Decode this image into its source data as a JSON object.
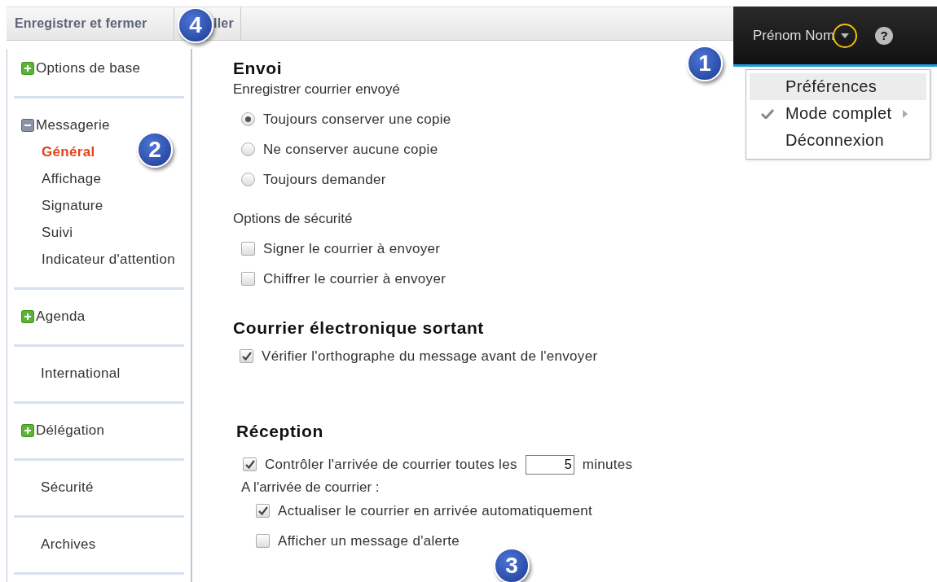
{
  "toolbar": {
    "buttons": [
      "Enregistrer et fermer",
      "ller"
    ]
  },
  "header": {
    "user_name": "Prénom Nom",
    "help": "?"
  },
  "user_menu": {
    "items": [
      {
        "label": "Préférences",
        "selected": true,
        "checked": false,
        "submenu": false
      },
      {
        "label": "Mode complet",
        "selected": false,
        "checked": true,
        "submenu": true
      },
      {
        "label": "Déconnexion",
        "selected": false,
        "checked": false,
        "submenu": false
      }
    ]
  },
  "sidebar": {
    "groups": [
      {
        "label": "Options de base",
        "kind": "collapsed",
        "selected": false
      },
      {
        "label": "Messagerie",
        "kind": "expanded",
        "selected": false,
        "children": [
          {
            "label": "Général",
            "selected": true
          },
          {
            "label": "Affichage",
            "selected": false
          },
          {
            "label": "Signature",
            "selected": false
          },
          {
            "label": "Suivi",
            "selected": false
          },
          {
            "label": "Indicateur d'attention",
            "selected": false
          }
        ]
      },
      {
        "label": "Agenda",
        "kind": "collapsed",
        "selected": false
      },
      {
        "label": "International",
        "kind": "leaf",
        "selected": false
      },
      {
        "label": "Délégation",
        "kind": "collapsed",
        "selected": false
      },
      {
        "label": "Sécurité",
        "kind": "leaf",
        "selected": false
      },
      {
        "label": "Archives",
        "kind": "leaf",
        "selected": false
      }
    ]
  },
  "sections": [
    {
      "title": "Envoi",
      "items": [
        {
          "kind": "label",
          "label": "Enregistrer courrier envoyé",
          "children": [
            {
              "kind": "radio",
              "label": "Toujours conserver une copie",
              "checked": true
            },
            {
              "kind": "radio",
              "label": "Ne conserver aucune copie",
              "checked": false
            },
            {
              "kind": "radio",
              "label": "Toujours demander",
              "checked": false
            }
          ]
        },
        {
          "kind": "label",
          "label": "Options de sécurité",
          "children": [
            {
              "kind": "checkbox",
              "label": "Signer le courrier à envoyer",
              "checked": false
            },
            {
              "kind": "checkbox",
              "label": "Chiffrer le courrier à envoyer",
              "checked": false
            }
          ]
        }
      ]
    },
    {
      "title": "Courrier électronique sortant",
      "items": [
        {
          "kind": "checkbox",
          "label": "Vérifier l'orthographe du message avant de l'envoyer",
          "checked": true
        }
      ]
    },
    {
      "title": "Réception",
      "items": [
        {
          "kind": "checkbox-input",
          "label": "Contrôler l'arrivée de courrier toutes les",
          "value": "5",
          "suffix": "minutes",
          "checked": true
        },
        {
          "kind": "label",
          "label": "A l'arrivée de courrier :",
          "children": [
            {
              "kind": "checkbox",
              "label": "Actualiser le courrier en arrivée automatiquement",
              "checked": true
            },
            {
              "kind": "checkbox",
              "label": "Afficher un message d'alerte",
              "checked": false
            }
          ]
        }
      ]
    }
  ],
  "callouts": [
    "1",
    "2",
    "3",
    "4"
  ]
}
